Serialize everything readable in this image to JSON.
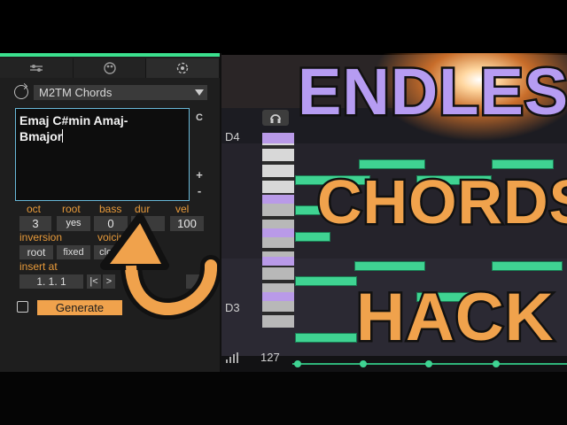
{
  "colors": {
    "accent_green": "#3be08e",
    "orange": "#f0a24c",
    "purple": "#b69cf2"
  },
  "device": {
    "preset_name": "M2TM Chords",
    "chords_text_line1": "Emaj C#min  Amaj-",
    "chords_text_line2": "Bmajor",
    "side_buttons": [
      "C",
      "+",
      "-"
    ],
    "param_labels": [
      "oct",
      "root",
      "bass",
      "dur",
      "vel"
    ],
    "param_values": [
      "3",
      "yes",
      "0",
      "",
      "100"
    ],
    "inversion_label": "inversion",
    "voicing_label": "voicing",
    "inversion_value": "root",
    "fixed_label": "fixed",
    "close_label": "close",
    "insert_label": "insert at",
    "insert_value": "1.   1.   1",
    "nav_prev": "|<",
    "nav_next": ">",
    "generate_label": "Generate"
  },
  "piano_roll": {
    "label_d4": "D4",
    "label_d3": "D3",
    "velocity_value": "127"
  },
  "headline": {
    "line1": "ENDLESS",
    "line2": "CHORDS",
    "line3": "HACK"
  }
}
